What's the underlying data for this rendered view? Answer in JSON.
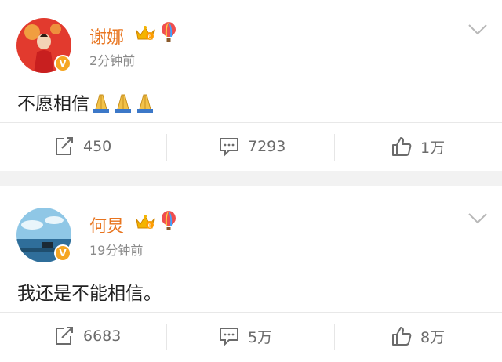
{
  "posts": [
    {
      "username": "谢娜",
      "timestamp": "2分钟前",
      "text": "不愿相信",
      "emoji": "praying-hands",
      "emoji_count": 3,
      "verified_mark": "V",
      "crown_level": "6",
      "actions": {
        "repost": "450",
        "comment": "7293",
        "like": "1万"
      }
    },
    {
      "username": "何炅",
      "timestamp": "19分钟前",
      "text": "我还是不能相信。",
      "verified_mark": "V",
      "crown_level": "6",
      "actions": {
        "repost": "6683",
        "comment": "5万",
        "like": "8万"
      }
    }
  ],
  "colors": {
    "username": "#e8741e",
    "verified": "#f5a623",
    "icon": "#6b6b6b",
    "background": "#f2f2f2"
  },
  "icons": {
    "repost": "repost-icon",
    "comment": "comment-icon",
    "like": "like-icon",
    "chevron": "chevron-down-icon",
    "crown": "crown-badge-icon",
    "balloon": "hot-air-balloon-icon"
  }
}
